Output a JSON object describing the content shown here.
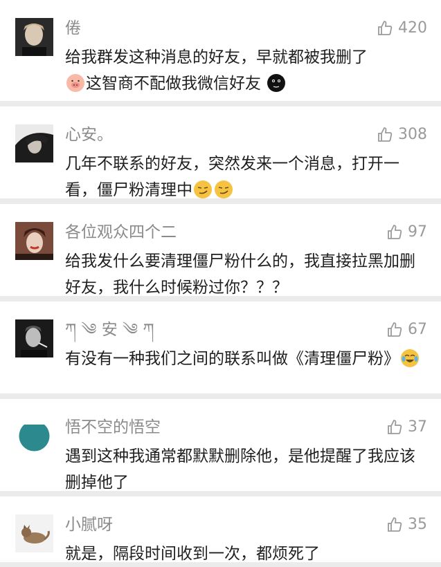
{
  "comments": [
    {
      "name": "倦",
      "likes": "420",
      "text_pre": "给我群发这种消息的好友，早就都被我删了",
      "text_mid": "这智商不配做我微信好友",
      "text_post": ""
    },
    {
      "name": "心安。",
      "likes": "308",
      "text_pre": "几年不联系的好友，突然发来一个消息，打开一看，僵尸粉清理中",
      "text_mid": "",
      "text_post": ""
    },
    {
      "name": "各位观众四个二",
      "likes": "97",
      "text_pre": "给我发什么要清理僵尸粉什么的，我直接拉黑加删好友，我什么时候粉过你？？？",
      "text_mid": "",
      "text_post": ""
    },
    {
      "name": "ཀ ༄ 安 ༄ ཀ",
      "likes": "67",
      "text_pre": "有没有一种我们之间的联系叫做《清理僵尸粉》",
      "text_mid": "",
      "text_post": ""
    },
    {
      "name": "悟不空的悟空",
      "likes": "37",
      "text_pre": "遇到这种我通常都默默删除他，是他提醒了我应该删掉他了",
      "text_mid": "",
      "text_post": ""
    },
    {
      "name": "小腻呀",
      "likes": "35",
      "text_pre": "就是，隔段时间收到一次，都烦死了",
      "text_mid": "",
      "text_post": ""
    }
  ],
  "icons": {
    "like": "thumbs-up-icon",
    "pig": "pig-face-emoji",
    "dark_moon": "dark-moon-face-emoji",
    "smirk": "smirk-face-emoji",
    "tears_of_joy": "tears-of-joy-emoji"
  },
  "colors": {
    "background": "#ebebeb",
    "name": "#8a8a8a",
    "likes": "#9a9a9a",
    "text": "#1f1f1f"
  }
}
